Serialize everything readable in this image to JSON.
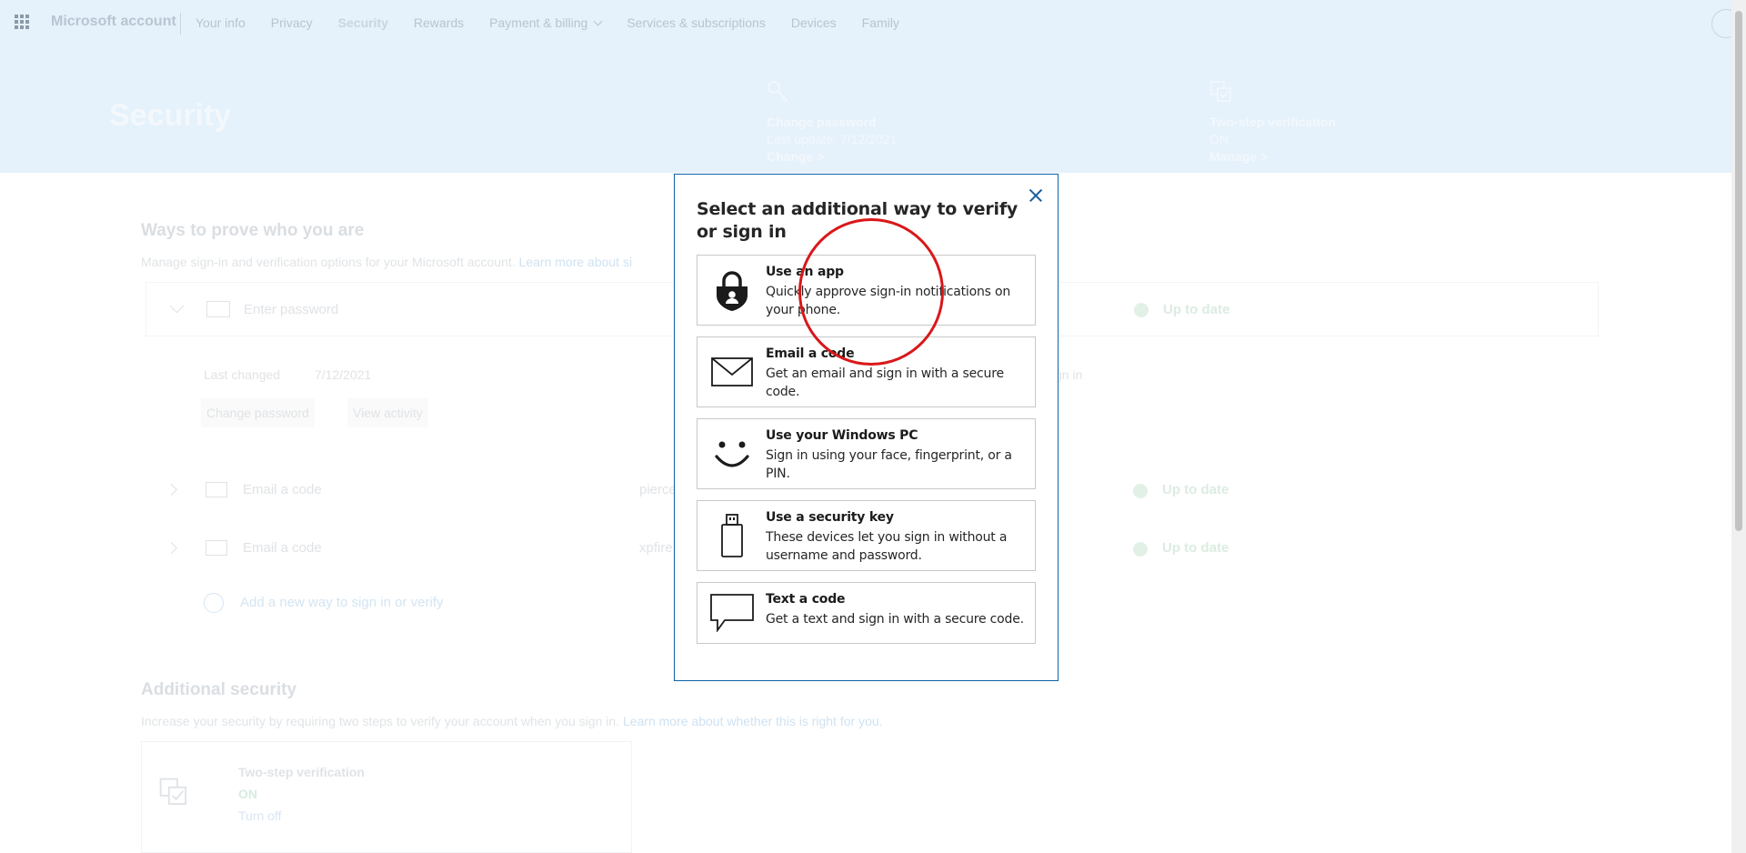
{
  "header": {
    "brand": "Microsoft account",
    "nav": [
      {
        "label": "Your info"
      },
      {
        "label": "Privacy"
      },
      {
        "label": "Security"
      },
      {
        "label": "Rewards"
      },
      {
        "label": "Payment & billing"
      },
      {
        "label": "Services & subscriptions"
      },
      {
        "label": "Devices"
      },
      {
        "label": "Family"
      }
    ]
  },
  "hero": {
    "title": "Security",
    "change_password": {
      "title": "Change password",
      "subtitle": "Last update: 7/12/2021",
      "link": "Change >",
      "icon": "key-icon"
    },
    "two_step": {
      "title": "Two-step verification",
      "subtitle": "ON",
      "link": "Manage >",
      "icon": "two-step-check-icon"
    }
  },
  "ways": {
    "heading": "Ways to prove who you are",
    "description": "Manage sign-in and verification options for your Microsoft account.",
    "learn_more": "Learn more about si",
    "rows": [
      {
        "label": "Enter password",
        "detail": "",
        "status": "Up to date"
      },
      {
        "label": "Email a code",
        "detail": "pierce",
        "status": "Up to date"
      },
      {
        "label": "Email a code",
        "detail": "xpfire",
        "status": "Up to date"
      }
    ],
    "last_changed_label": "Last changed",
    "last_changed_value": "7/12/2021",
    "change_password_btn": "Change password",
    "view_activity_btn": "View activity",
    "right_text": "gn in",
    "add_new": "Add a new way to sign in or verify"
  },
  "additional": {
    "heading": "Additional security",
    "description": "Increase your security by requiring two steps to verify your account when you sign in.",
    "learn_more": "Learn more about whether this is right for you.",
    "two_step_title": "Two-step verification",
    "two_step_status": "ON",
    "turn_off": "Turn off"
  },
  "dialog": {
    "title": "Select an additional way to verify or sign in",
    "options": [
      {
        "title": "Use an app",
        "description": "Quickly approve sign-in notifications on your phone.",
        "icon": "authenticator-lock-icon"
      },
      {
        "title": "Email a code",
        "description": "Get an email and sign in with a secure code.",
        "icon": "envelope-icon"
      },
      {
        "title": "Use your Windows PC",
        "description": "Sign in using your face, fingerprint, or a PIN.",
        "icon": "smiley-face-icon"
      },
      {
        "title": "Use a security key",
        "description": "These devices let you sign in without a username and password.",
        "icon": "usb-key-icon"
      },
      {
        "title": "Text a code",
        "description": "Get a text and sign in with a secure code.",
        "icon": "speech-bubble-icon"
      }
    ]
  },
  "colors": {
    "accent": "#0b63a8",
    "hero_bg": "#e5f1fb",
    "annotation": "#d9171a"
  }
}
